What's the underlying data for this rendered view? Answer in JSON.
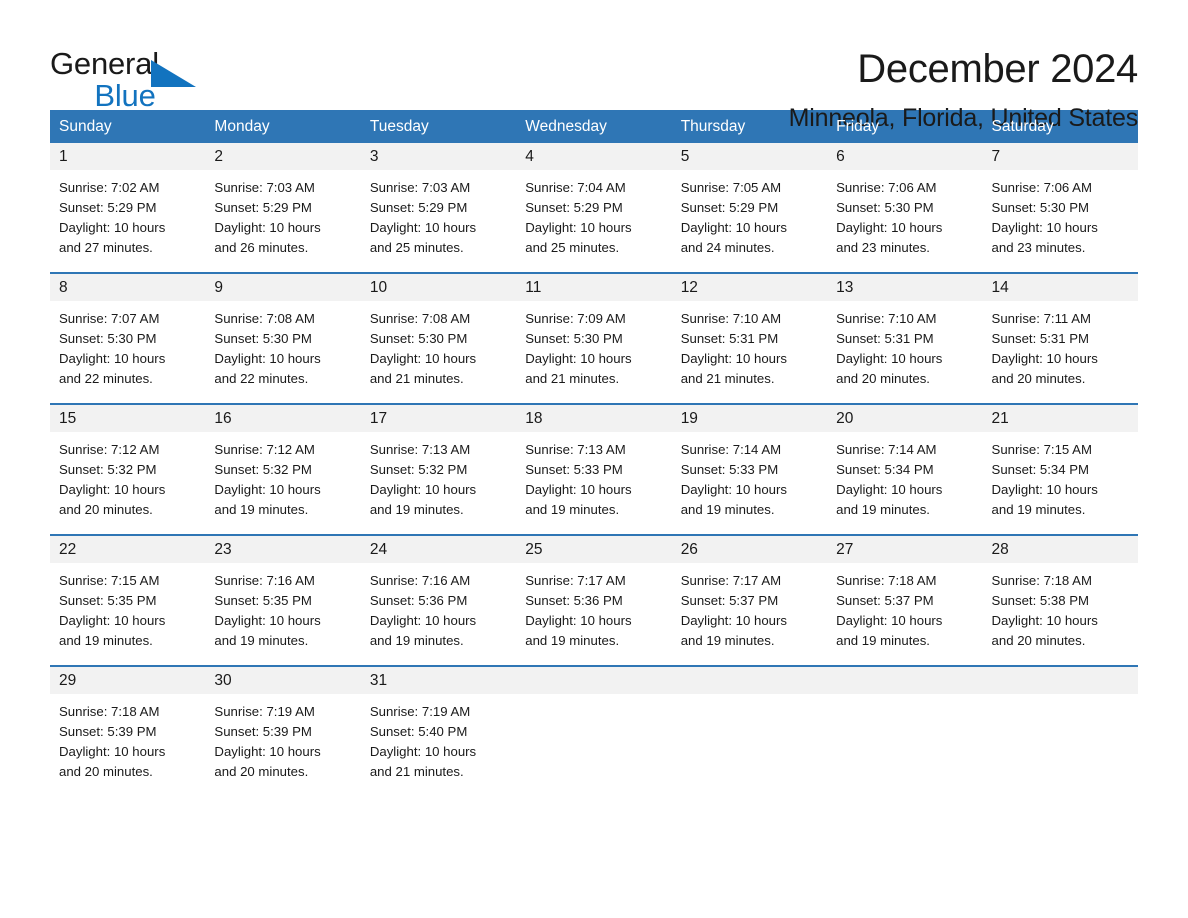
{
  "brand": {
    "name_part1": "General",
    "name_part2": "Blue",
    "accent_color": "#1273bf",
    "triangle_icon": "triangle-icon"
  },
  "header": {
    "title": "December 2024",
    "subtitle": "Minneola, Florida, United States"
  },
  "calendar": {
    "header_bg": "#2f76b5",
    "daynum_bg": "#f2f2f2",
    "weekdays": [
      "Sunday",
      "Monday",
      "Tuesday",
      "Wednesday",
      "Thursday",
      "Friday",
      "Saturday"
    ],
    "weeks": [
      [
        {
          "day": "1",
          "sunrise": "Sunrise: 7:02 AM",
          "sunset": "Sunset: 5:29 PM",
          "daylight_l1": "Daylight: 10 hours",
          "daylight_l2": "and 27 minutes."
        },
        {
          "day": "2",
          "sunrise": "Sunrise: 7:03 AM",
          "sunset": "Sunset: 5:29 PM",
          "daylight_l1": "Daylight: 10 hours",
          "daylight_l2": "and 26 minutes."
        },
        {
          "day": "3",
          "sunrise": "Sunrise: 7:03 AM",
          "sunset": "Sunset: 5:29 PM",
          "daylight_l1": "Daylight: 10 hours",
          "daylight_l2": "and 25 minutes."
        },
        {
          "day": "4",
          "sunrise": "Sunrise: 7:04 AM",
          "sunset": "Sunset: 5:29 PM",
          "daylight_l1": "Daylight: 10 hours",
          "daylight_l2": "and 25 minutes."
        },
        {
          "day": "5",
          "sunrise": "Sunrise: 7:05 AM",
          "sunset": "Sunset: 5:29 PM",
          "daylight_l1": "Daylight: 10 hours",
          "daylight_l2": "and 24 minutes."
        },
        {
          "day": "6",
          "sunrise": "Sunrise: 7:06 AM",
          "sunset": "Sunset: 5:30 PM",
          "daylight_l1": "Daylight: 10 hours",
          "daylight_l2": "and 23 minutes."
        },
        {
          "day": "7",
          "sunrise": "Sunrise: 7:06 AM",
          "sunset": "Sunset: 5:30 PM",
          "daylight_l1": "Daylight: 10 hours",
          "daylight_l2": "and 23 minutes."
        }
      ],
      [
        {
          "day": "8",
          "sunrise": "Sunrise: 7:07 AM",
          "sunset": "Sunset: 5:30 PM",
          "daylight_l1": "Daylight: 10 hours",
          "daylight_l2": "and 22 minutes."
        },
        {
          "day": "9",
          "sunrise": "Sunrise: 7:08 AM",
          "sunset": "Sunset: 5:30 PM",
          "daylight_l1": "Daylight: 10 hours",
          "daylight_l2": "and 22 minutes."
        },
        {
          "day": "10",
          "sunrise": "Sunrise: 7:08 AM",
          "sunset": "Sunset: 5:30 PM",
          "daylight_l1": "Daylight: 10 hours",
          "daylight_l2": "and 21 minutes."
        },
        {
          "day": "11",
          "sunrise": "Sunrise: 7:09 AM",
          "sunset": "Sunset: 5:30 PM",
          "daylight_l1": "Daylight: 10 hours",
          "daylight_l2": "and 21 minutes."
        },
        {
          "day": "12",
          "sunrise": "Sunrise: 7:10 AM",
          "sunset": "Sunset: 5:31 PM",
          "daylight_l1": "Daylight: 10 hours",
          "daylight_l2": "and 21 minutes."
        },
        {
          "day": "13",
          "sunrise": "Sunrise: 7:10 AM",
          "sunset": "Sunset: 5:31 PM",
          "daylight_l1": "Daylight: 10 hours",
          "daylight_l2": "and 20 minutes."
        },
        {
          "day": "14",
          "sunrise": "Sunrise: 7:11 AM",
          "sunset": "Sunset: 5:31 PM",
          "daylight_l1": "Daylight: 10 hours",
          "daylight_l2": "and 20 minutes."
        }
      ],
      [
        {
          "day": "15",
          "sunrise": "Sunrise: 7:12 AM",
          "sunset": "Sunset: 5:32 PM",
          "daylight_l1": "Daylight: 10 hours",
          "daylight_l2": "and 20 minutes."
        },
        {
          "day": "16",
          "sunrise": "Sunrise: 7:12 AM",
          "sunset": "Sunset: 5:32 PM",
          "daylight_l1": "Daylight: 10 hours",
          "daylight_l2": "and 19 minutes."
        },
        {
          "day": "17",
          "sunrise": "Sunrise: 7:13 AM",
          "sunset": "Sunset: 5:32 PM",
          "daylight_l1": "Daylight: 10 hours",
          "daylight_l2": "and 19 minutes."
        },
        {
          "day": "18",
          "sunrise": "Sunrise: 7:13 AM",
          "sunset": "Sunset: 5:33 PM",
          "daylight_l1": "Daylight: 10 hours",
          "daylight_l2": "and 19 minutes."
        },
        {
          "day": "19",
          "sunrise": "Sunrise: 7:14 AM",
          "sunset": "Sunset: 5:33 PM",
          "daylight_l1": "Daylight: 10 hours",
          "daylight_l2": "and 19 minutes."
        },
        {
          "day": "20",
          "sunrise": "Sunrise: 7:14 AM",
          "sunset": "Sunset: 5:34 PM",
          "daylight_l1": "Daylight: 10 hours",
          "daylight_l2": "and 19 minutes."
        },
        {
          "day": "21",
          "sunrise": "Sunrise: 7:15 AM",
          "sunset": "Sunset: 5:34 PM",
          "daylight_l1": "Daylight: 10 hours",
          "daylight_l2": "and 19 minutes."
        }
      ],
      [
        {
          "day": "22",
          "sunrise": "Sunrise: 7:15 AM",
          "sunset": "Sunset: 5:35 PM",
          "daylight_l1": "Daylight: 10 hours",
          "daylight_l2": "and 19 minutes."
        },
        {
          "day": "23",
          "sunrise": "Sunrise: 7:16 AM",
          "sunset": "Sunset: 5:35 PM",
          "daylight_l1": "Daylight: 10 hours",
          "daylight_l2": "and 19 minutes."
        },
        {
          "day": "24",
          "sunrise": "Sunrise: 7:16 AM",
          "sunset": "Sunset: 5:36 PM",
          "daylight_l1": "Daylight: 10 hours",
          "daylight_l2": "and 19 minutes."
        },
        {
          "day": "25",
          "sunrise": "Sunrise: 7:17 AM",
          "sunset": "Sunset: 5:36 PM",
          "daylight_l1": "Daylight: 10 hours",
          "daylight_l2": "and 19 minutes."
        },
        {
          "day": "26",
          "sunrise": "Sunrise: 7:17 AM",
          "sunset": "Sunset: 5:37 PM",
          "daylight_l1": "Daylight: 10 hours",
          "daylight_l2": "and 19 minutes."
        },
        {
          "day": "27",
          "sunrise": "Sunrise: 7:18 AM",
          "sunset": "Sunset: 5:37 PM",
          "daylight_l1": "Daylight: 10 hours",
          "daylight_l2": "and 19 minutes."
        },
        {
          "day": "28",
          "sunrise": "Sunrise: 7:18 AM",
          "sunset": "Sunset: 5:38 PM",
          "daylight_l1": "Daylight: 10 hours",
          "daylight_l2": "and 20 minutes."
        }
      ],
      [
        {
          "day": "29",
          "sunrise": "Sunrise: 7:18 AM",
          "sunset": "Sunset: 5:39 PM",
          "daylight_l1": "Daylight: 10 hours",
          "daylight_l2": "and 20 minutes."
        },
        {
          "day": "30",
          "sunrise": "Sunrise: 7:19 AM",
          "sunset": "Sunset: 5:39 PM",
          "daylight_l1": "Daylight: 10 hours",
          "daylight_l2": "and 20 minutes."
        },
        {
          "day": "31",
          "sunrise": "Sunrise: 7:19 AM",
          "sunset": "Sunset: 5:40 PM",
          "daylight_l1": "Daylight: 10 hours",
          "daylight_l2": "and 21 minutes."
        },
        {
          "day": "",
          "sunrise": "",
          "sunset": "",
          "daylight_l1": "",
          "daylight_l2": ""
        },
        {
          "day": "",
          "sunrise": "",
          "sunset": "",
          "daylight_l1": "",
          "daylight_l2": ""
        },
        {
          "day": "",
          "sunrise": "",
          "sunset": "",
          "daylight_l1": "",
          "daylight_l2": ""
        },
        {
          "day": "",
          "sunrise": "",
          "sunset": "",
          "daylight_l1": "",
          "daylight_l2": ""
        }
      ]
    ]
  }
}
